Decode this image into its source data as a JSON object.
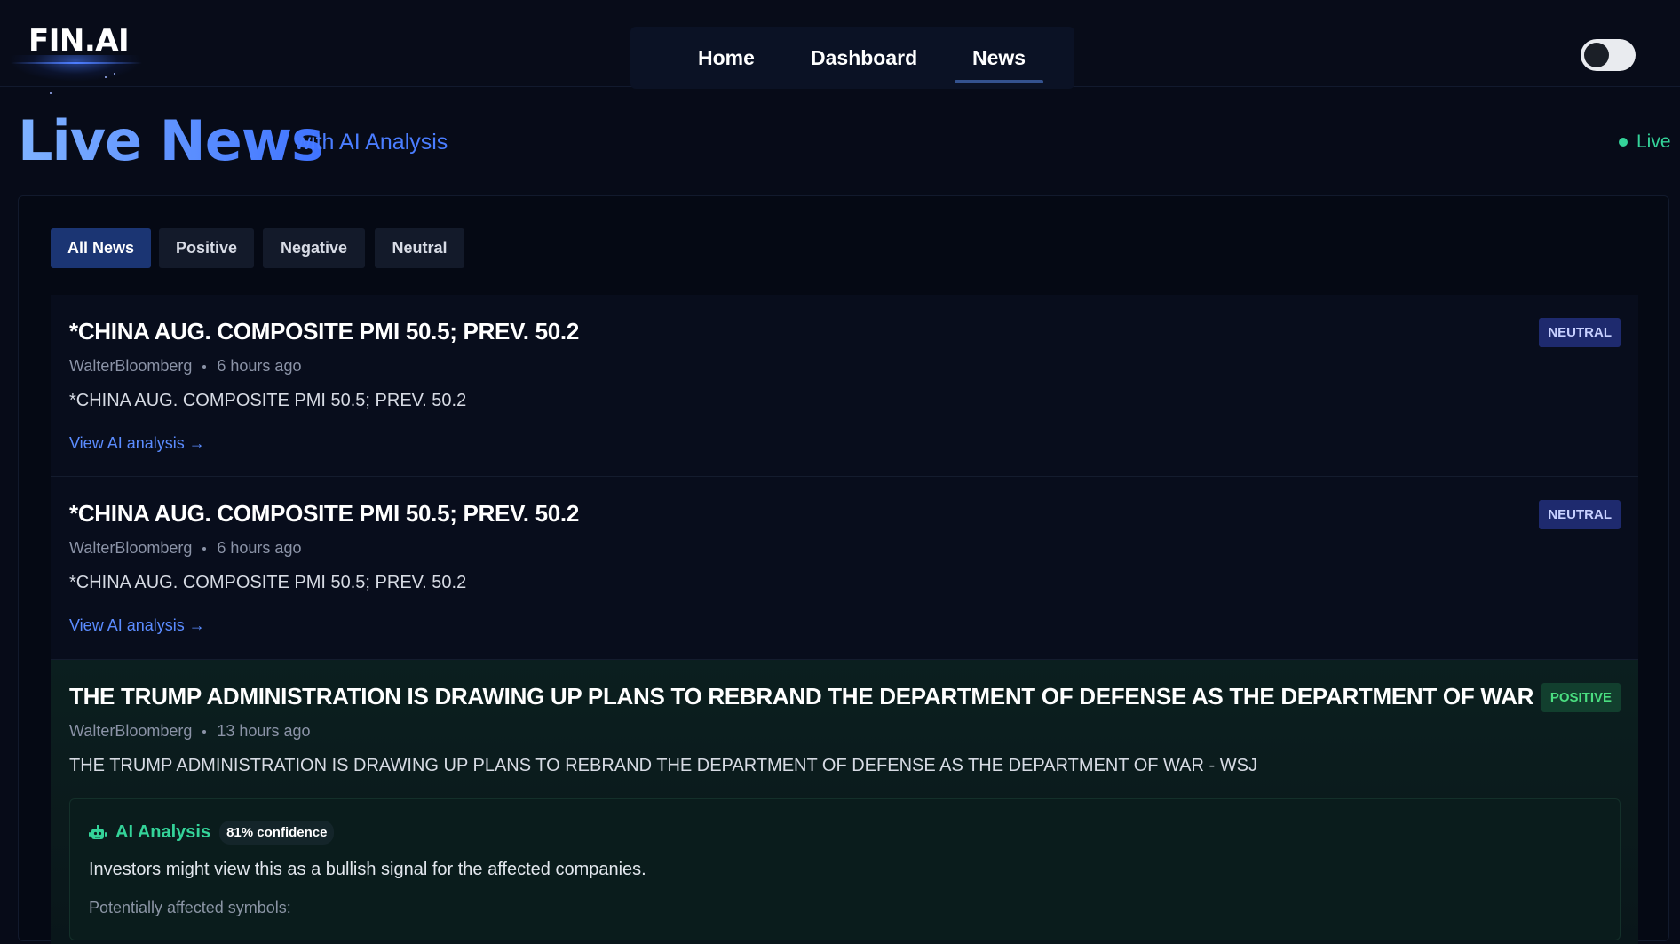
{
  "header": {
    "logo": "FIN.AI",
    "nav": [
      "Home",
      "Dashboard",
      "News"
    ],
    "active_nav": "News",
    "theme_toggle": "dark"
  },
  "page": {
    "title": "Live News",
    "subtitle": "with AI Analysis",
    "live_label": "Live"
  },
  "filters": {
    "all": "All News",
    "positive": "Positive",
    "negative": "Negative",
    "neutral": "Neutral",
    "active": "All News"
  },
  "news": [
    {
      "title": "*CHINA AUG. COMPOSITE PMI 50.5; PREV. 50.2",
      "source": "WalterBloomberg",
      "time": "6 hours ago",
      "body": "*CHINA AUG. COMPOSITE PMI 50.5; PREV. 50.2",
      "link": "View AI analysis →",
      "sentiment": "NEUTRAL"
    },
    {
      "title": "*CHINA AUG. COMPOSITE PMI 50.5; PREV. 50.2",
      "source": "WalterBloomberg",
      "time": "6 hours ago",
      "body": "*CHINA AUG. COMPOSITE PMI 50.5; PREV. 50.2",
      "link": "View AI analysis →",
      "sentiment": "NEUTRAL"
    },
    {
      "title": "THE TRUMP ADMINISTRATION IS DRAWING UP PLANS TO REBRAND THE DEPARTMENT OF DEFENSE AS THE DEPARTMENT OF WAR - WSJ",
      "source": "WalterBloomberg",
      "time": "13 hours ago",
      "body": "THE TRUMP ADMINISTRATION IS DRAWING UP PLANS TO REBRAND THE DEPARTMENT OF DEFENSE AS THE DEPARTMENT OF WAR - WSJ",
      "sentiment": "POSITIVE",
      "analysis": {
        "label": "AI Analysis",
        "confidence": "81% confidence",
        "text": "Investors might view this as a bullish signal for the affected companies.",
        "symbols_label": "Potentially affected symbols:"
      }
    }
  ],
  "colors": {
    "accent": "#4a7dff",
    "positive": "#34d399",
    "neutral_badge": "#1e2a6e",
    "background": "#070b18"
  }
}
